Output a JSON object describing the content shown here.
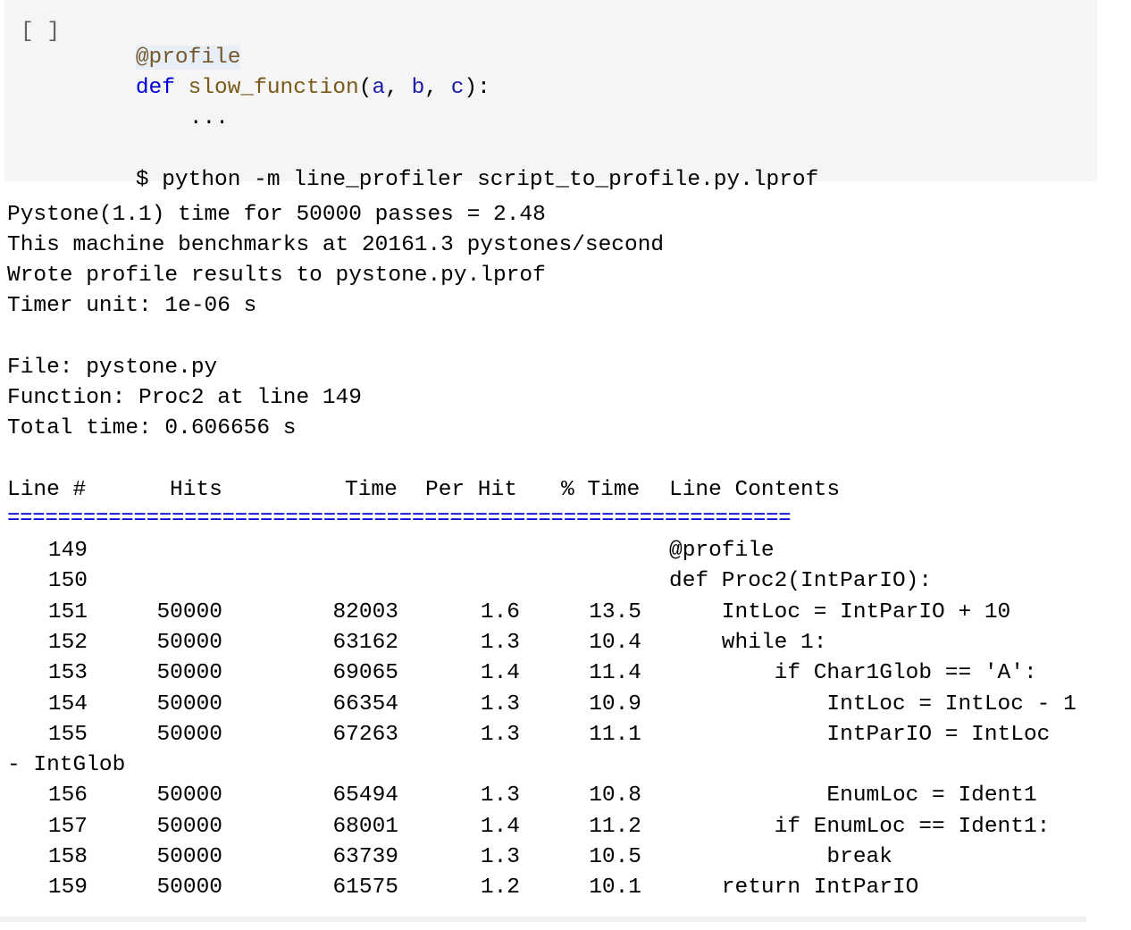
{
  "cell": {
    "prompt": "[ ]",
    "code": {
      "decorator": "@profile",
      "def_kw": "def",
      "func_name": "slow_function",
      "open_paren": "(",
      "arg_a": "a",
      "comma1": ", ",
      "arg_b": "b",
      "comma2": ", ",
      "arg_c": "c",
      "close": "):",
      "ellipsis": "...",
      "command": "$ python -m line_profiler script_to_profile.py.lprof"
    }
  },
  "output": {
    "summary": [
      "Pystone(1.1) time for 50000 passes = 2.48",
      "This machine benchmarks at 20161.3 pystones/second",
      "Wrote profile results to pystone.py.lprof",
      "Timer unit: 1e-06 s"
    ],
    "file_info": [
      "File: pystone.py",
      "Function: Proc2 at line 149",
      "Total time: 0.606656 s"
    ],
    "table": {
      "headers": {
        "line": "Line #",
        "hits": "Hits",
        "time": "Time",
        "per_hit": "Per Hit",
        "pct_time": "% Time",
        "contents": "Line Contents"
      },
      "separator": "==============================================================",
      "rows": [
        {
          "line": "149",
          "hits": "",
          "time": "",
          "per_hit": "",
          "pct": "",
          "contents": "@profile"
        },
        {
          "line": "150",
          "hits": "",
          "time": "",
          "per_hit": "",
          "pct": "",
          "contents": "def Proc2(IntParIO):"
        },
        {
          "line": "151",
          "hits": "50000",
          "time": "82003",
          "per_hit": "1.6",
          "pct": "13.5",
          "contents": "    IntLoc = IntParIO + 10"
        },
        {
          "line": "152",
          "hits": "50000",
          "time": "63162",
          "per_hit": "1.3",
          "pct": "10.4",
          "contents": "    while 1:"
        },
        {
          "line": "153",
          "hits": "50000",
          "time": "69065",
          "per_hit": "1.4",
          "pct": "11.4",
          "contents": "        if Char1Glob == 'A':"
        },
        {
          "line": "154",
          "hits": "50000",
          "time": "66354",
          "per_hit": "1.3",
          "pct": "10.9",
          "contents": "            IntLoc = IntLoc - 1"
        },
        {
          "line": "155",
          "hits": "50000",
          "time": "67263",
          "per_hit": "1.3",
          "pct": "11.1",
          "contents": "            IntParIO = IntLoc"
        },
        {
          "line": "",
          "hits": "",
          "time": "",
          "per_hit": "",
          "pct": "",
          "contents": "",
          "wrap": "- IntGlob"
        },
        {
          "line": "156",
          "hits": "50000",
          "time": "65494",
          "per_hit": "1.3",
          "pct": "10.8",
          "contents": "            EnumLoc = Ident1"
        },
        {
          "line": "157",
          "hits": "50000",
          "time": "68001",
          "per_hit": "1.4",
          "pct": "11.2",
          "contents": "        if EnumLoc == Ident1:"
        },
        {
          "line": "158",
          "hits": "50000",
          "time": "63739",
          "per_hit": "1.3",
          "pct": "10.5",
          "contents": "            break"
        },
        {
          "line": "159",
          "hits": "50000",
          "time": "61575",
          "per_hit": "1.2",
          "pct": "10.1",
          "contents": "    return IntParIO"
        }
      ]
    }
  },
  "colors": {
    "cell_background": "#f5f5f5",
    "keyword": "#0000d6",
    "function_name": "#7a5a18",
    "decorator": "#75582e",
    "separator": "#0000d6"
  }
}
